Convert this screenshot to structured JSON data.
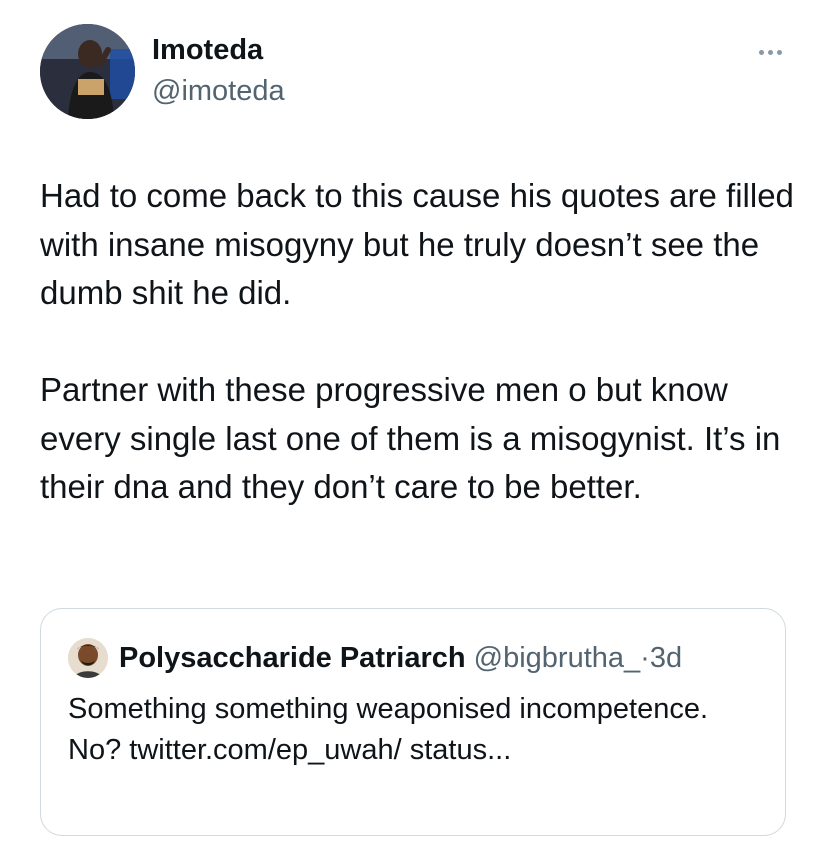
{
  "tweet": {
    "author": {
      "display_name": "Imoteda",
      "handle": "@imoteda",
      "avatar_icon": "profile-photo-icon"
    },
    "more_icon": "more-horizontal-icon",
    "paragraphs": [
      "Had to come back to this cause his quotes are filled with insane misogyny but he truly doesn’t see the dumb shit he did.",
      "Partner with these progressive men o but know every single last one of them is a misogynist. It’s in their dna and they don’t care to be better."
    ]
  },
  "quoted_tweet": {
    "author": {
      "display_name": "Polysaccharide Patriarch",
      "handle": "@bigbrutha_",
      "separator": "·",
      "time": "3d",
      "avatar_icon": "profile-photo-icon"
    },
    "text": "Something something weaponised incompetence. No? twitter.com/ep_uwah/ status..."
  }
}
